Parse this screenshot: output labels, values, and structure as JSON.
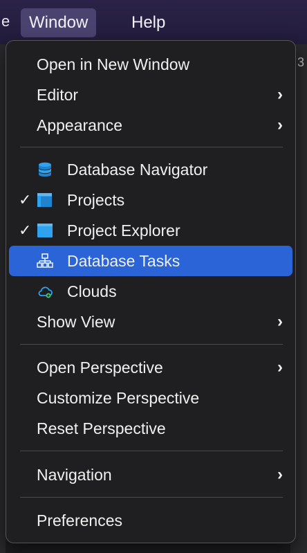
{
  "menubar": {
    "edge_char": "e",
    "window_label": "Window",
    "help_label": "Help"
  },
  "background": {
    "edge_num": "3"
  },
  "menu": {
    "open_new_window": "Open in New Window",
    "editor": "Editor",
    "appearance": "Appearance",
    "database_navigator": "Database Navigator",
    "projects": "Projects",
    "project_explorer": "Project Explorer",
    "database_tasks": "Database Tasks",
    "clouds": "Clouds",
    "show_view": "Show View",
    "open_perspective": "Open Perspective",
    "customize_perspective": "Customize Perspective",
    "reset_perspective": "Reset Perspective",
    "navigation": "Navigation",
    "preferences": "Preferences",
    "checkmark": "✓",
    "submenu_arrow": "›"
  },
  "colors": {
    "highlight": "#2a64d6",
    "menu_bg": "#1f1f21",
    "icon_blue": "#2fa3f0",
    "icon_green": "#3ec46d"
  },
  "icons": {
    "database_navigator": "database-stack-icon",
    "projects": "projects-window-icon",
    "project_explorer": "project-explorer-window-icon",
    "database_tasks": "task-hierarchy-icon",
    "clouds": "cloud-icon"
  }
}
